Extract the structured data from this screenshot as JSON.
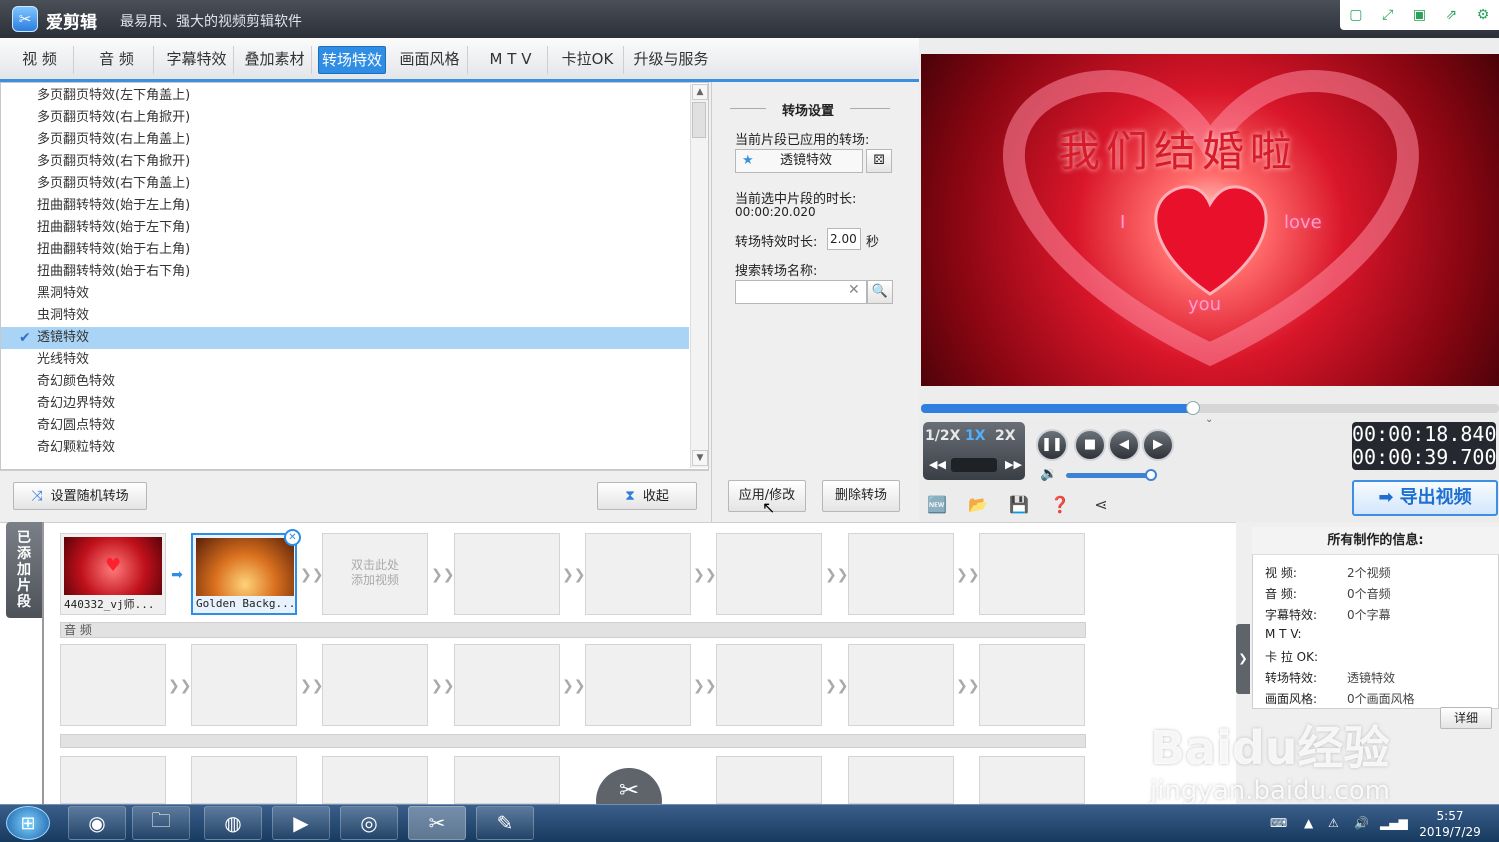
{
  "app": {
    "name": "爱剪辑",
    "slogan": "最易用、强大的视频剪辑软件"
  },
  "tabs": [
    "视 频",
    "音 频",
    "字幕特效",
    "叠加素材",
    "转场特效",
    "画面风格",
    "M T V",
    "卡拉OK",
    "升级与服务"
  ],
  "active_tab": "转场特效",
  "effects": [
    "多页翻页特效(左下角盖上)",
    "多页翻页特效(右上角掀开)",
    "多页翻页特效(右上角盖上)",
    "多页翻页特效(右下角掀开)",
    "多页翻页特效(右下角盖上)",
    "扭曲翻转特效(始于左上角)",
    "扭曲翻转特效(始于左下角)",
    "扭曲翻转特效(始于右上角)",
    "扭曲翻转特效(始于右下角)",
    "黑洞特效",
    "虫洞特效",
    "透镜特效",
    "光线特效",
    "奇幻颜色特效",
    "奇幻边界特效",
    "奇幻圆点特效",
    "奇幻颗粒特效"
  ],
  "selected_effect": "透镜特效",
  "list_buttons": {
    "random": "设置随机转场",
    "collapse": "收起"
  },
  "settings": {
    "heading": "转场设置",
    "applied_label": "当前片段已应用的转场:",
    "applied_value": "透镜特效",
    "clip_duration_label": "当前选中片段的时长:",
    "clip_duration_value": "00:00:20.020",
    "effect_duration_label": "转场特效时长:",
    "effect_duration_value": "2.00",
    "effect_duration_unit": "秒",
    "search_label": "搜索转场名称:",
    "search_value": "",
    "apply_button": "应用/修改",
    "delete_button": "删除转场"
  },
  "preview": {
    "video_title": "我们结婚啦",
    "word_i": "I",
    "word_love": "love",
    "word_you": "you",
    "progress": 0.47,
    "speed_options": [
      "1/2X",
      "1X",
      "2X"
    ],
    "active_speed": "1X",
    "current_time": "00:00:18.840",
    "total_time": "00:00:39.700",
    "volume": 1.0,
    "export_button": "导出视频"
  },
  "timeline": {
    "added_tab": "已添加片段",
    "clips": [
      {
        "label": "440332_vj师..."
      },
      {
        "label": "Golden Backg..."
      }
    ],
    "add_hint_line1": "双击此处",
    "add_hint_line2": "添加视频",
    "audio_label": "音 频"
  },
  "info": {
    "title": "所有制作的信息:",
    "rows": [
      {
        "key": "视      频:",
        "value": "2个视频"
      },
      {
        "key": "音      频:",
        "value": "0个音频"
      },
      {
        "key": "字幕特效:",
        "value": "0个字幕"
      },
      {
        "key": "M   T   V:",
        "value": ""
      },
      {
        "key": "卡 拉 OK:",
        "value": ""
      },
      {
        "key": "转场特效:",
        "value": "透镜特效"
      },
      {
        "key": "画面风格:",
        "value": "0个画面风格"
      }
    ],
    "detail_button": "详细"
  },
  "taskbar": {
    "time": "5:57",
    "date": "2019/7/29"
  },
  "watermark": {
    "brand": "Baidu经验",
    "url": "jingyan.baidu.com"
  },
  "colors": {
    "accent": "#2f8de4",
    "selection": "#aad4f5",
    "export": "#1e6fd0"
  }
}
